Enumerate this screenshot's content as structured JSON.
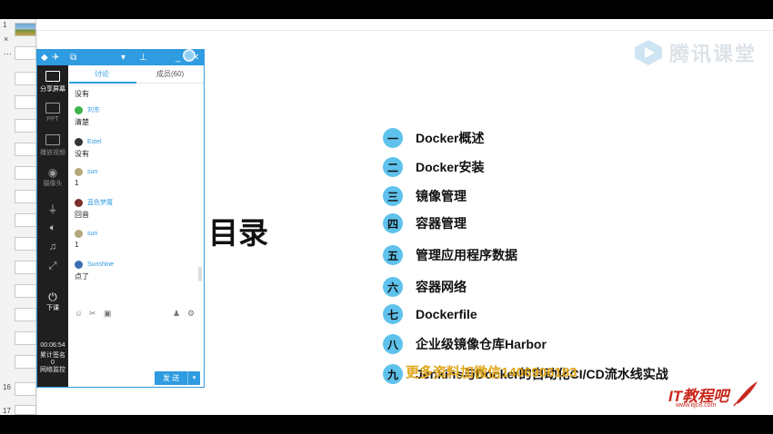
{
  "thumbnails": {
    "numbers": [
      "1",
      "16",
      "17"
    ],
    "marks": [
      "×",
      "…"
    ]
  },
  "slide": {
    "logo_text": "腾讯课堂",
    "title": "目录",
    "toc": [
      {
        "num": "一",
        "text": "Docker概述"
      },
      {
        "num": "二",
        "text": "Docker安装"
      },
      {
        "num": "三",
        "text": "镜像管理"
      },
      {
        "num": "四",
        "text": "容器管理"
      },
      {
        "num": "五",
        "text": "管理应用程序数据"
      },
      {
        "num": "六",
        "text": "容器网络"
      },
      {
        "num": "七",
        "text": "Dockerfile"
      },
      {
        "num": "八",
        "text": "企业级镜像仓库Harbor"
      },
      {
        "num": "九",
        "text": "Jenkins与Docker的自动化CI/CD流水线实战"
      }
    ],
    "watermark": "更多资料加微信1406906183",
    "brand_main": "IT教程吧",
    "brand_url": "www.itjc8.com"
  },
  "panel": {
    "tools": {
      "share_screen": "分享屏幕",
      "ppt": "PPT",
      "play_video": "播放视频",
      "camera": "摄像头",
      "end_class": "下课"
    },
    "stats": {
      "elapsed": "00:06:54",
      "cumulative": "累计签名",
      "cumulative_value": "0",
      "network": "网络监控"
    },
    "tabs": {
      "discussion": "讨论",
      "members": "成员(60)"
    },
    "messages": [
      {
        "user": "",
        "text": "没有",
        "avatar_color": "#9bb6c9"
      },
      {
        "user": "刘东",
        "text": "清楚",
        "avatar_color": "#3cb44a"
      },
      {
        "user": "Estel",
        "text": "没有",
        "avatar_color": "#333333"
      },
      {
        "user": "sun",
        "text": "1",
        "avatar_color": "#b4a87a"
      },
      {
        "user": "蓝色梦魇",
        "text": "回音",
        "avatar_color": "#7a2f2a"
      },
      {
        "user": "sun",
        "text": "1",
        "avatar_color": "#b4a87a"
      },
      {
        "user": "Sunshine",
        "text": "点了",
        "avatar_color": "#3a6fb4"
      }
    ],
    "send_label": "发 送",
    "send_arrow": "▾"
  },
  "colors": {
    "accent": "#2f9be0",
    "toc_badge": "#5ec2ec",
    "watermark": "#e0a61a",
    "brand": "#c8281e"
  }
}
